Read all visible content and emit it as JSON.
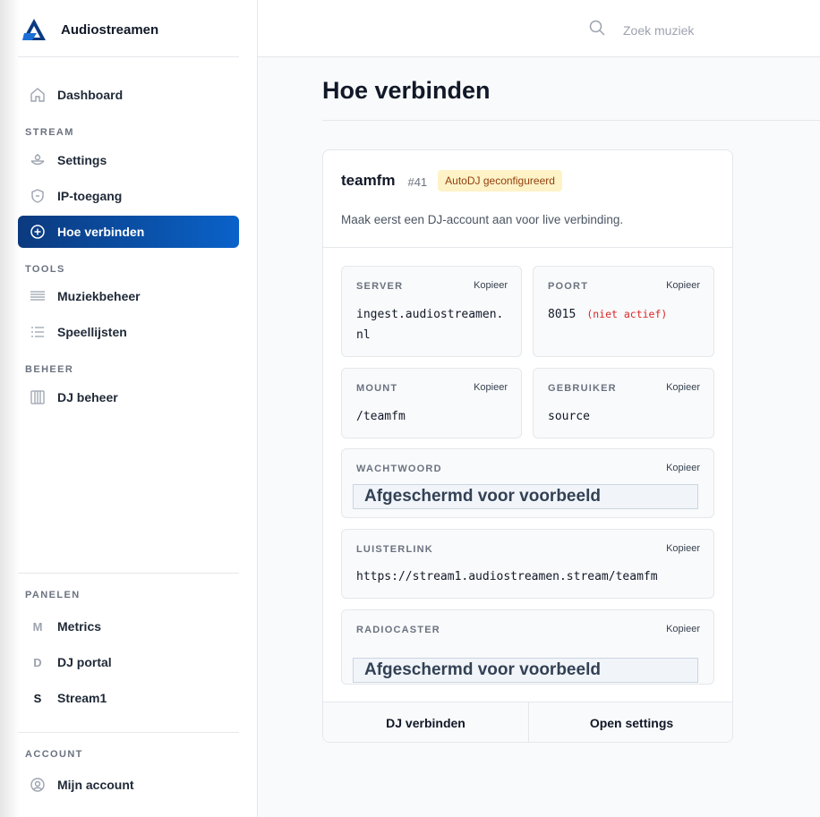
{
  "app": {
    "name": "Audiostreamen"
  },
  "search": {
    "placeholder": "Zoek muziek",
    "icon": "search-icon"
  },
  "sidebar": {
    "dashboard": {
      "label": "Dashboard",
      "icon": "home-icon"
    },
    "sections": {
      "stream": "STREAM",
      "tools": "TOOLS",
      "beheer": "BEHEER",
      "panelen": "PANELEN",
      "account": "ACCOUNT"
    },
    "stream_items": [
      {
        "label": "Settings",
        "icon": "mixer-icon"
      },
      {
        "label": "IP-toegang",
        "icon": "shield-icon"
      },
      {
        "label": "Hoe verbinden",
        "icon": "plus-circle-icon",
        "active": true
      }
    ],
    "tools_items": [
      {
        "label": "Muziekbeheer",
        "icon": "list-icon"
      },
      {
        "label": "Speellijsten",
        "icon": "playlist-icon"
      }
    ],
    "beheer_items": [
      {
        "label": "DJ beheer",
        "icon": "columns-icon"
      }
    ],
    "panel_items": [
      {
        "letter": "M",
        "label": "Metrics"
      },
      {
        "letter": "D",
        "label": "DJ portal"
      },
      {
        "letter": "S",
        "label": "Stream1"
      }
    ],
    "account_items": [
      {
        "label": "Mijn account",
        "icon": "user-circle-icon"
      }
    ]
  },
  "page": {
    "title": "Hoe verbinden"
  },
  "card": {
    "stream_name": "teamfm",
    "stream_id": "#41",
    "badge": "AutoDJ geconfigureerd",
    "subtitle": "Maak eerst een DJ-account aan voor live verbinding.",
    "copy_label": "Kopieer",
    "fields": {
      "server": {
        "label": "SERVER",
        "value_line1": "ingest.audiostreamen.",
        "value_line2": "nl"
      },
      "port": {
        "label": "POORT",
        "value": "8015",
        "note": "(niet actief)"
      },
      "mount": {
        "label": "MOUNT",
        "value": "/teamfm"
      },
      "user": {
        "label": "GEBRUIKER",
        "value": "source"
      },
      "password": {
        "label": "WACHTWOORD",
        "masked": "Afgeschermd voor voorbeeld"
      },
      "listen": {
        "label": "LUISTERLINK",
        "value": "https://stream1.audiostreamen.stream/teamfm"
      },
      "radiocaster": {
        "label": "RADIOCASTER",
        "masked": "Afgeschermd voor voorbeeld"
      }
    },
    "footer": {
      "connect": "DJ verbinden",
      "settings": "Open settings"
    }
  },
  "colors": {
    "accent_start": "#0b3a7e",
    "accent_end": "#0a62c9",
    "badge_bg": "#fef3c7",
    "badge_text": "#92400e",
    "inactive": "#dc2626"
  }
}
